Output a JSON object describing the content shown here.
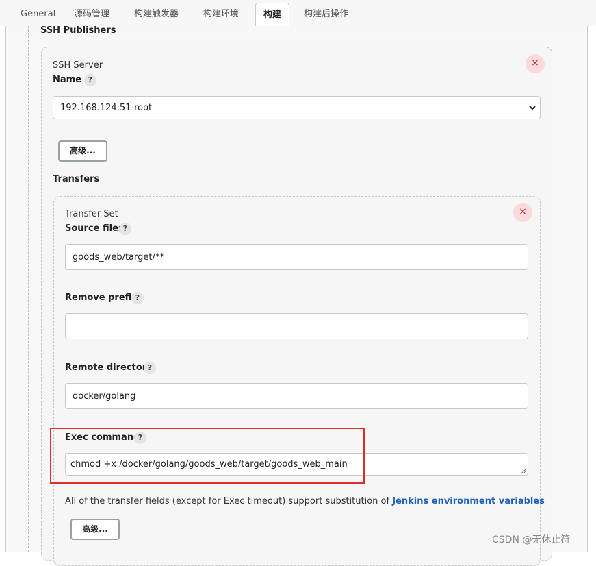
{
  "tabs": [
    "General",
    "源码管理",
    "构建触发器",
    "构建环境",
    "构建",
    "构建后操作"
  ],
  "section_title": "SSH Publishers",
  "ssh_server": {
    "heading": "SSH Server",
    "name_label": "Name",
    "name_value": "192.168.124.51-root",
    "advanced_label": "高级..."
  },
  "transfers_label": "Transfers",
  "transfer_set": {
    "heading": "Transfer Set",
    "source_files_label": "Source files",
    "source_files_value": "goods_web/target/**",
    "remove_prefix_label": "Remove prefix",
    "remove_prefix_value": "",
    "remote_directory_label": "Remote directory",
    "remote_directory_value": "docker/golang",
    "exec_command_label": "Exec command",
    "exec_command_value": "chmod +x /docker/golang/goods_web/target/goods_web_main",
    "note_prefix": "All of the transfer fields (except for Exec timeout) support substitution of",
    "note_link": "Jenkins environment variables",
    "advanced_label": "高级..."
  },
  "help_glyph": "?",
  "close_glyph": "×",
  "watermark": "CSDN @无休止符",
  "colors": {
    "highlight": "#e02b2b",
    "link": "#1f5fbf",
    "close_bg": "#fadadd"
  }
}
